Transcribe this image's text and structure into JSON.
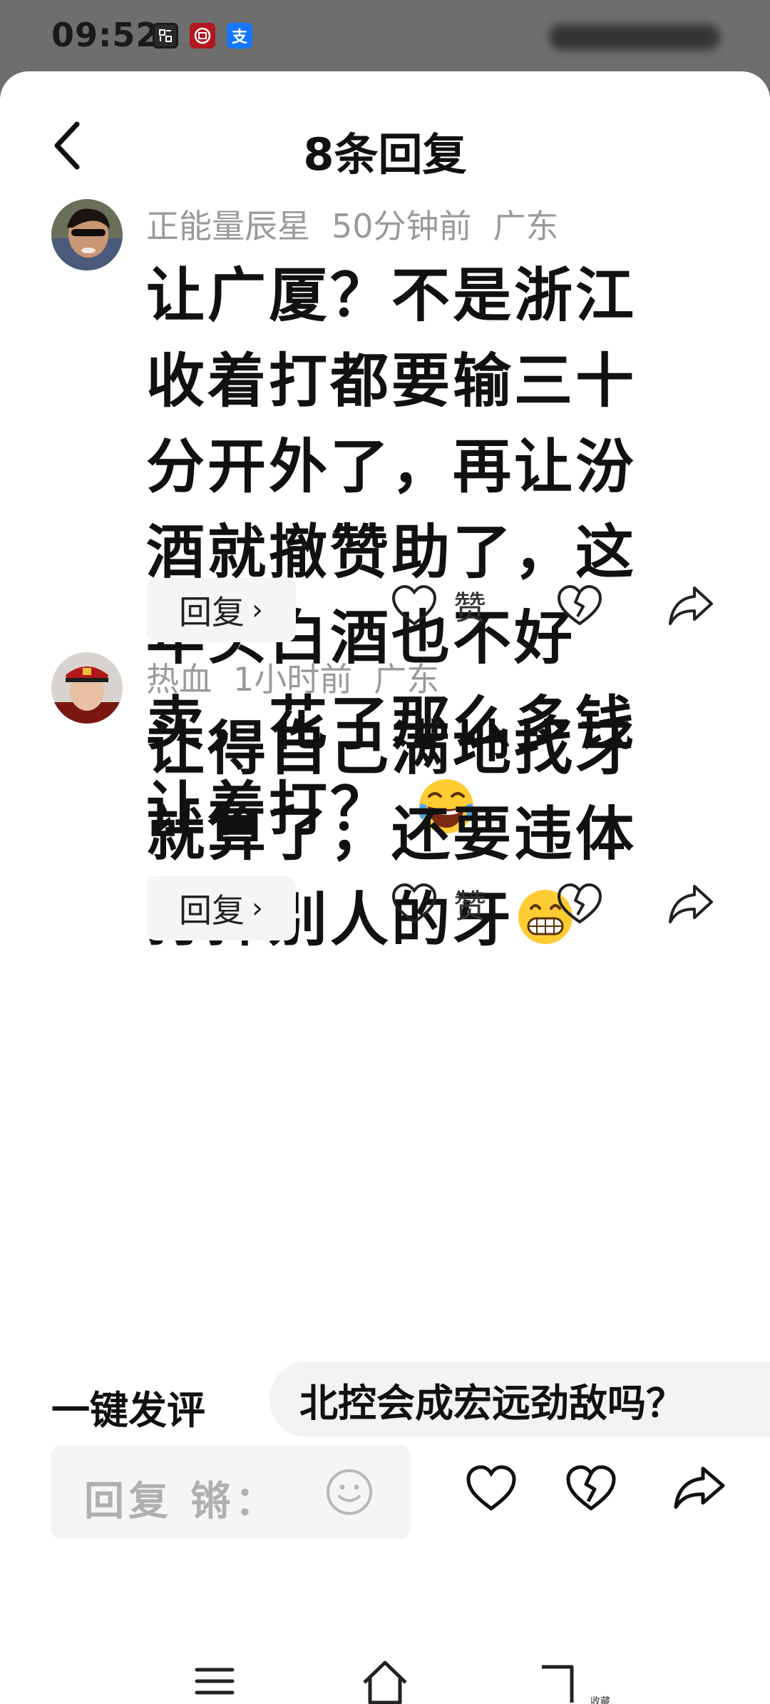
{
  "status": {
    "time": "09:52",
    "icons": [
      "scan-app-icon",
      "bank-app-icon",
      "alipay-icon"
    ],
    "alipay_glyph": "支"
  },
  "header": {
    "title": "8条回复",
    "back_icon": "chevron-left-icon"
  },
  "comments": [
    {
      "author": "正能量辰星",
      "time": "50分钟前",
      "location": "广东",
      "lines": [
        "让广厦？不是浙江",
        "收着打都要输三十",
        "分开外了，再让汾",
        "酒就撤赞助了，这",
        "年头白酒也不好",
        "卖，花了那么多钱",
        "让着打？"
      ],
      "emoji": "tears-of-joy-emoji",
      "reply_label": "回复",
      "like_label": "赞"
    },
    {
      "author": "热血",
      "time": "1小时前",
      "location": "广东",
      "lines": [
        "让得自己满地找牙",
        "就算了，还要违体",
        "打掉别人的牙"
      ],
      "emoji": "grinning-emoji",
      "reply_label": "回复",
      "like_label": "赞"
    }
  ],
  "quick_comment": {
    "label": "一键发评",
    "suggestion": "北控会成宏远劲敌吗？"
  },
  "reply_input": {
    "placeholder": "回复 锵："
  },
  "nav": {
    "tiny_text": "收藏"
  },
  "colors": {
    "text": "#111111",
    "meta": "#9a9a9a",
    "chip_bg": "#f5f5f5",
    "status_bg": "#6e6e6e"
  }
}
